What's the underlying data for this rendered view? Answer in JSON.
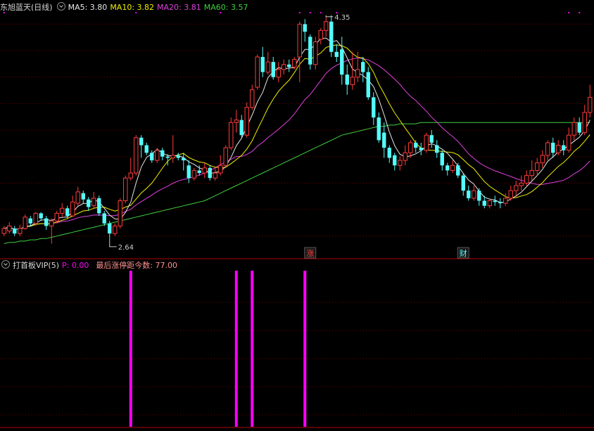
{
  "header": {
    "stock_label": "东旭蓝天(日线)",
    "ma_items": [
      {
        "label": "MA5: 3.80",
        "color": "#e8e8e8"
      },
      {
        "label": "MA10: 3.82",
        "color": "#f0f000"
      },
      {
        "label": "MA20: 3.81",
        "color": "#e040e0"
      },
      {
        "label": "MA60: 3.57",
        "color": "#40d040"
      }
    ]
  },
  "indicator": {
    "name": "打首板VIP(5)",
    "p_label": "P: 0.00",
    "info_label": "最后涨停距今数: 77.00"
  },
  "colors": {
    "up": "#ff3c3c",
    "down": "#54fcfc",
    "ma5": "#e8e8e8",
    "ma10": "#f0f000",
    "ma20": "#e040e0",
    "ma60": "#40d040",
    "grid": "#7a0000",
    "signal": "#ff00ff"
  },
  "chart_data": {
    "type": "candlestick",
    "ylim": [
      2.5,
      4.44
    ],
    "y_grid": [
      2.68,
      2.89,
      3.1,
      3.31,
      3.52,
      3.73,
      3.94,
      4.15,
      4.36
    ],
    "candles": [
      [
        2.7,
        2.74,
        2.68,
        2.76
      ],
      [
        2.72,
        2.76,
        2.7,
        2.79
      ],
      [
        2.74,
        2.7,
        2.68,
        2.76
      ],
      [
        2.7,
        2.74,
        2.68,
        2.77
      ],
      [
        2.74,
        2.83,
        2.73,
        2.85
      ],
      [
        2.82,
        2.78,
        2.76,
        2.84
      ],
      [
        2.78,
        2.86,
        2.76,
        2.87
      ],
      [
        2.86,
        2.82,
        2.8,
        2.87
      ],
      [
        2.82,
        2.76,
        2.73,
        2.84
      ],
      [
        2.76,
        2.8,
        2.62,
        2.82
      ],
      [
        2.8,
        2.86,
        2.78,
        2.88
      ],
      [
        2.86,
        2.9,
        2.83,
        2.94
      ],
      [
        2.9,
        2.84,
        2.82,
        2.92
      ],
      [
        2.84,
        2.95,
        2.83,
        3.0
      ],
      [
        2.94,
        3.03,
        2.92,
        3.07
      ],
      [
        3.02,
        2.97,
        2.94,
        3.04
      ],
      [
        2.97,
        2.91,
        2.88,
        2.99
      ],
      [
        2.92,
        2.98,
        2.9,
        3.03
      ],
      [
        2.98,
        2.86,
        2.84,
        3.0
      ],
      [
        2.86,
        2.78,
        2.76,
        2.88
      ],
      [
        2.78,
        2.7,
        2.64,
        2.8
      ],
      [
        2.7,
        2.76,
        2.68,
        2.78
      ],
      [
        2.76,
        2.96,
        2.74,
        2.98
      ],
      [
        2.96,
        3.14,
        2.94,
        3.16
      ],
      [
        3.14,
        3.18,
        3.12,
        3.3
      ],
      [
        3.18,
        3.46,
        3.16,
        3.48
      ],
      [
        3.46,
        3.4,
        3.3,
        3.48
      ],
      [
        3.4,
        3.34,
        3.32,
        3.42
      ],
      [
        3.34,
        3.28,
        3.26,
        3.36
      ],
      [
        3.28,
        3.36,
        3.26,
        3.38
      ],
      [
        3.36,
        3.31,
        3.28,
        3.38
      ],
      [
        3.31,
        3.3,
        3.24,
        3.33
      ],
      [
        3.3,
        3.32,
        3.26,
        3.48
      ],
      [
        3.32,
        3.3,
        3.28,
        3.34
      ],
      [
        3.3,
        3.28,
        3.2,
        3.34
      ],
      [
        3.24,
        3.14,
        3.1,
        3.28
      ],
      [
        3.14,
        3.2,
        3.12,
        3.22
      ],
      [
        3.2,
        3.18,
        3.16,
        3.24
      ],
      [
        3.18,
        3.22,
        3.14,
        3.26
      ],
      [
        3.22,
        3.14,
        3.12,
        3.24
      ],
      [
        3.14,
        3.18,
        3.12,
        3.22
      ],
      [
        3.18,
        3.24,
        3.16,
        3.32
      ],
      [
        3.24,
        3.38,
        3.22,
        3.4
      ],
      [
        3.38,
        3.58,
        3.36,
        3.62
      ],
      [
        3.58,
        3.6,
        3.5,
        3.68
      ],
      [
        3.6,
        3.48,
        3.46,
        3.64
      ],
      [
        3.48,
        3.7,
        3.46,
        3.74
      ],
      [
        3.7,
        3.84,
        3.68,
        3.88
      ],
      [
        3.86,
        4.1,
        3.84,
        4.12
      ],
      [
        4.1,
        3.98,
        3.94,
        4.18
      ],
      [
        3.98,
        4.06,
        3.96,
        4.14
      ],
      [
        4.06,
        3.94,
        3.92,
        4.1
      ],
      [
        3.94,
        4.0,
        3.9,
        4.06
      ],
      [
        4.0,
        4.04,
        3.96,
        4.08
      ],
      [
        4.04,
        4.02,
        3.98,
        4.08
      ],
      [
        4.02,
        4.08,
        4.0,
        4.1
      ],
      [
        4.1,
        4.36,
        3.9,
        4.38
      ],
      [
        4.36,
        4.3,
        4.22,
        4.4
      ],
      [
        4.26,
        4.04,
        4.0,
        4.28
      ],
      [
        4.04,
        4.22,
        4.0,
        4.26
      ],
      [
        4.24,
        4.31,
        4.2,
        4.33
      ],
      [
        4.31,
        4.38,
        4.26,
        4.42
      ],
      [
        4.38,
        4.14,
        4.1,
        4.43
      ],
      [
        4.14,
        4.1,
        4.06,
        4.2
      ],
      [
        4.16,
        3.96,
        3.88,
        4.26
      ],
      [
        3.96,
        3.88,
        3.8,
        4.04
      ],
      [
        3.88,
        3.94,
        3.84,
        4.14
      ],
      [
        3.94,
        4.0,
        3.9,
        4.14
      ],
      [
        4.06,
        3.98,
        3.9,
        4.1
      ],
      [
        3.98,
        3.78,
        3.76,
        4.02
      ],
      [
        3.78,
        3.62,
        3.56,
        3.82
      ],
      [
        3.62,
        3.44,
        3.42,
        3.66
      ],
      [
        3.5,
        3.38,
        3.3,
        3.58
      ],
      [
        3.38,
        3.3,
        3.26,
        3.4
      ],
      [
        3.32,
        3.24,
        3.2,
        3.34
      ],
      [
        3.24,
        3.28,
        3.2,
        3.31
      ],
      [
        3.28,
        3.34,
        3.24,
        3.4
      ],
      [
        3.34,
        3.42,
        3.3,
        3.44
      ],
      [
        3.42,
        3.38,
        3.34,
        3.44
      ],
      [
        3.38,
        3.36,
        3.32,
        3.42
      ],
      [
        3.36,
        3.48,
        3.34,
        3.5
      ],
      [
        3.48,
        3.42,
        3.38,
        3.52
      ],
      [
        3.4,
        3.34,
        3.3,
        3.44
      ],
      [
        3.34,
        3.24,
        3.2,
        3.36
      ],
      [
        3.24,
        3.2,
        3.16,
        3.26
      ],
      [
        3.2,
        3.24,
        3.18,
        3.28
      ],
      [
        3.24,
        3.16,
        3.14,
        3.26
      ],
      [
        3.16,
        3.04,
        3.0,
        3.18
      ],
      [
        3.04,
        2.98,
        2.96,
        3.08
      ],
      [
        2.98,
        3.04,
        2.96,
        3.08
      ],
      [
        3.04,
        2.96,
        2.92,
        3.06
      ],
      [
        2.96,
        2.92,
        2.9,
        3.0
      ],
      [
        2.92,
        2.96,
        2.9,
        2.98
      ],
      [
        2.96,
        2.95,
        2.92,
        3.0
      ],
      [
        2.95,
        2.94,
        2.9,
        2.98
      ],
      [
        2.94,
        2.98,
        2.92,
        3.02
      ],
      [
        2.98,
        3.04,
        2.96,
        3.08
      ],
      [
        3.04,
        3.08,
        3.0,
        3.12
      ],
      [
        3.08,
        3.1,
        3.04,
        3.16
      ],
      [
        3.1,
        3.16,
        3.08,
        3.2
      ],
      [
        3.16,
        3.2,
        3.12,
        3.28
      ],
      [
        3.2,
        3.26,
        3.16,
        3.3
      ],
      [
        3.26,
        3.32,
        3.22,
        3.36
      ],
      [
        3.32,
        3.42,
        3.28,
        3.44
      ],
      [
        3.42,
        3.34,
        3.3,
        3.46
      ],
      [
        3.34,
        3.4,
        3.32,
        3.44
      ],
      [
        3.4,
        3.36,
        3.32,
        3.44
      ],
      [
        3.36,
        3.48,
        3.34,
        3.54
      ],
      [
        3.48,
        3.58,
        3.44,
        3.62
      ],
      [
        3.58,
        3.5,
        3.48,
        3.62
      ],
      [
        3.5,
        3.66,
        3.48,
        3.72
      ],
      [
        3.66,
        3.78,
        3.62,
        3.88
      ]
    ],
    "ma60": [
      2.62,
      2.63,
      2.63,
      2.64,
      2.64,
      2.65,
      2.65,
      2.66,
      2.66,
      2.67,
      2.68,
      2.69,
      2.7,
      2.71,
      2.72,
      2.73,
      2.74,
      2.75,
      2.76,
      2.77,
      2.78,
      2.79,
      2.8,
      2.81,
      2.82,
      2.83,
      2.84,
      2.85,
      2.86,
      2.87,
      2.88,
      2.89,
      2.9,
      2.91,
      2.92,
      2.93,
      2.94,
      2.95,
      2.96,
      2.98,
      3.0,
      3.02,
      3.04,
      3.06,
      3.08,
      3.1,
      3.12,
      3.14,
      3.16,
      3.18,
      3.2,
      3.22,
      3.24,
      3.26,
      3.28,
      3.3,
      3.32,
      3.34,
      3.36,
      3.38,
      3.4,
      3.42,
      3.44,
      3.46,
      3.48,
      3.49,
      3.5,
      3.51,
      3.52,
      3.53,
      3.54,
      3.55,
      3.55,
      3.56,
      3.56,
      3.57,
      3.57,
      3.57,
      3.57,
      3.58,
      3.58,
      3.58,
      3.58,
      3.58,
      3.58,
      3.58,
      3.58,
      3.58,
      3.58,
      3.58,
      3.58,
      3.58,
      3.58,
      3.58,
      3.58,
      3.58,
      3.58,
      3.58,
      3.58,
      3.58,
      3.58,
      3.58,
      3.58,
      3.58,
      3.58,
      3.58,
      3.58,
      3.58,
      3.58,
      3.58,
      3.58,
      3.58
    ],
    "marks": [
      {
        "index": 61,
        "price": 4.43,
        "label": "4.35"
      },
      {
        "index": 20,
        "price": 2.64,
        "label": "2.64"
      }
    ],
    "event_labels": [
      {
        "index": 58,
        "label": "涨",
        "color": "#ff3c3c"
      },
      {
        "index": 87,
        "label": "财",
        "color": "#54fcfc"
      }
    ],
    "top_dots": [
      0,
      25,
      41,
      56,
      58,
      60,
      63,
      107,
      109
    ],
    "signals": [
      24,
      44,
      47,
      57
    ],
    "signal_value": 1
  }
}
